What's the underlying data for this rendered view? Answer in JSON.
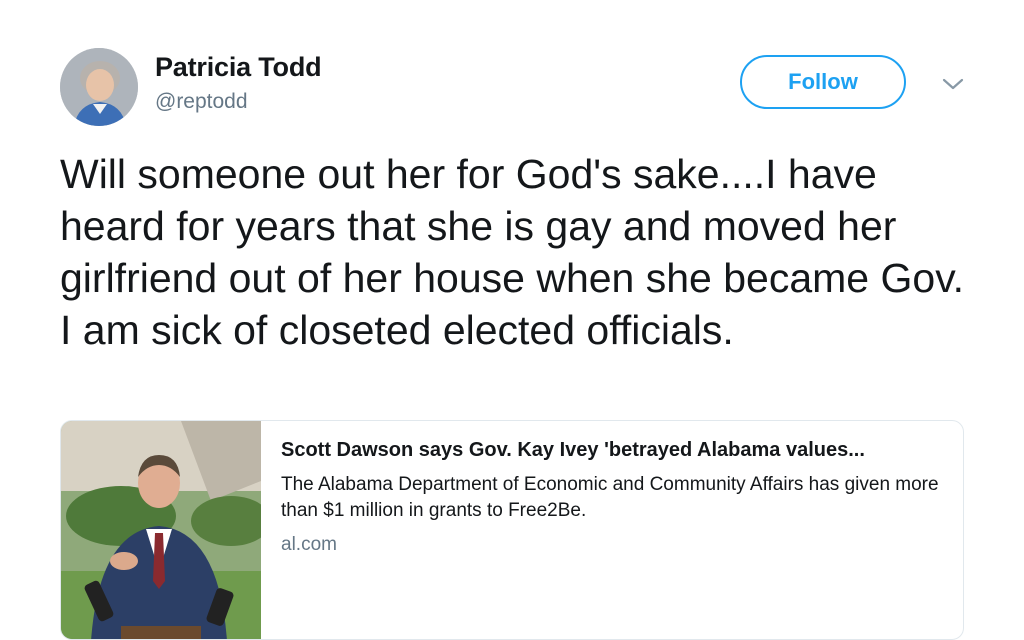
{
  "author": {
    "name": "Patricia Todd",
    "handle": "@reptodd"
  },
  "actions": {
    "follow_label": "Follow"
  },
  "icons": {
    "avatar": "user-avatar",
    "menu": "chevron-down-icon"
  },
  "tweet": {
    "text": "Will someone out her for God's sake....I have heard for years that she is gay and moved her girlfriend out of her house when she became Gov.  I am sick of closeted elected officials."
  },
  "card": {
    "title": "Scott Dawson says Gov. Kay Ivey 'betrayed Alabama values...",
    "description": "The Alabama Department of Economic and Community Affairs has given more than $1 million in grants to Free2Be.",
    "domain": "al.com"
  },
  "colors": {
    "accent": "#1da1f2",
    "text": "#14171a",
    "muted": "#657786",
    "border": "#e1e8ed"
  }
}
